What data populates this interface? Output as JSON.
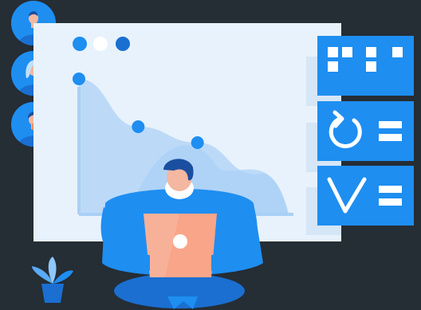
{
  "avatars": [
    {
      "icon": "user-avatar-icon",
      "hair": "#1a6fd1"
    },
    {
      "icon": "user-avatar-icon",
      "hair": "#bfe1fb"
    },
    {
      "icon": "user-avatar-icon",
      "hair": "#1a6fd1"
    }
  ],
  "window_dots": [
    {
      "color": "#1e8ef1"
    },
    {
      "color": "#ffffff"
    },
    {
      "color": "#1a6fd1"
    }
  ],
  "chart_data": {
    "type": "area",
    "series": [
      {
        "values": [
          0.85,
          0.55,
          0.45,
          0.25
        ]
      }
    ],
    "grid": false
  },
  "side_cards": [
    {
      "icon": "grid-icon"
    },
    {
      "icon": "refresh-icon"
    },
    {
      "icon": "checkmark-icon"
    }
  ],
  "colors": {
    "background": "#252d35",
    "accent": "#1e8ef1",
    "accent_dark": "#1a6fd1",
    "panel": "#e8f2fc",
    "laptop": "#f9a58a",
    "skin": "#f4b7a0"
  }
}
